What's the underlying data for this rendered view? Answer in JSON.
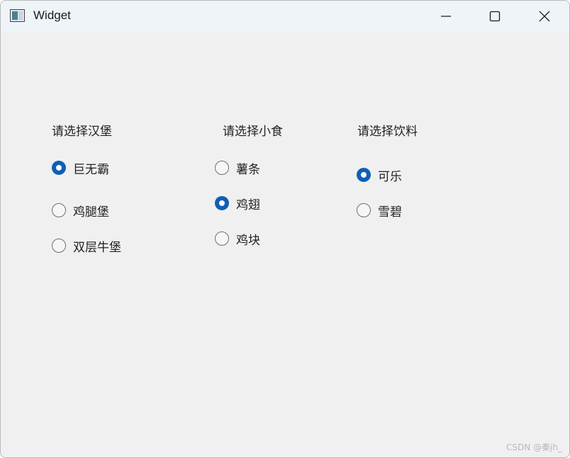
{
  "window": {
    "title": "Widget",
    "icon": "qt-widget-app-icon",
    "controls": [
      "minimize-icon",
      "maximize-icon",
      "close-icon"
    ]
  },
  "groups": [
    {
      "title": "请选择汉堡",
      "options": [
        {
          "label": "巨无霸",
          "checked": true
        },
        {
          "label": "鸡腿堡",
          "checked": false
        },
        {
          "label": "双层牛堡",
          "checked": false
        }
      ]
    },
    {
      "title": "请选择小食",
      "options": [
        {
          "label": "薯条",
          "checked": false
        },
        {
          "label": "鸡翅",
          "checked": true
        },
        {
          "label": "鸡块",
          "checked": false
        }
      ]
    },
    {
      "title": "请选择饮料",
      "options": [
        {
          "label": "可乐",
          "checked": true
        },
        {
          "label": "雪碧",
          "checked": false
        }
      ]
    }
  ],
  "colors": {
    "radio_checked": "#0f5fb4",
    "background": "#f0f0f0",
    "titlebar": "#eff4f9"
  },
  "watermark": "CSDN @秦jh_"
}
